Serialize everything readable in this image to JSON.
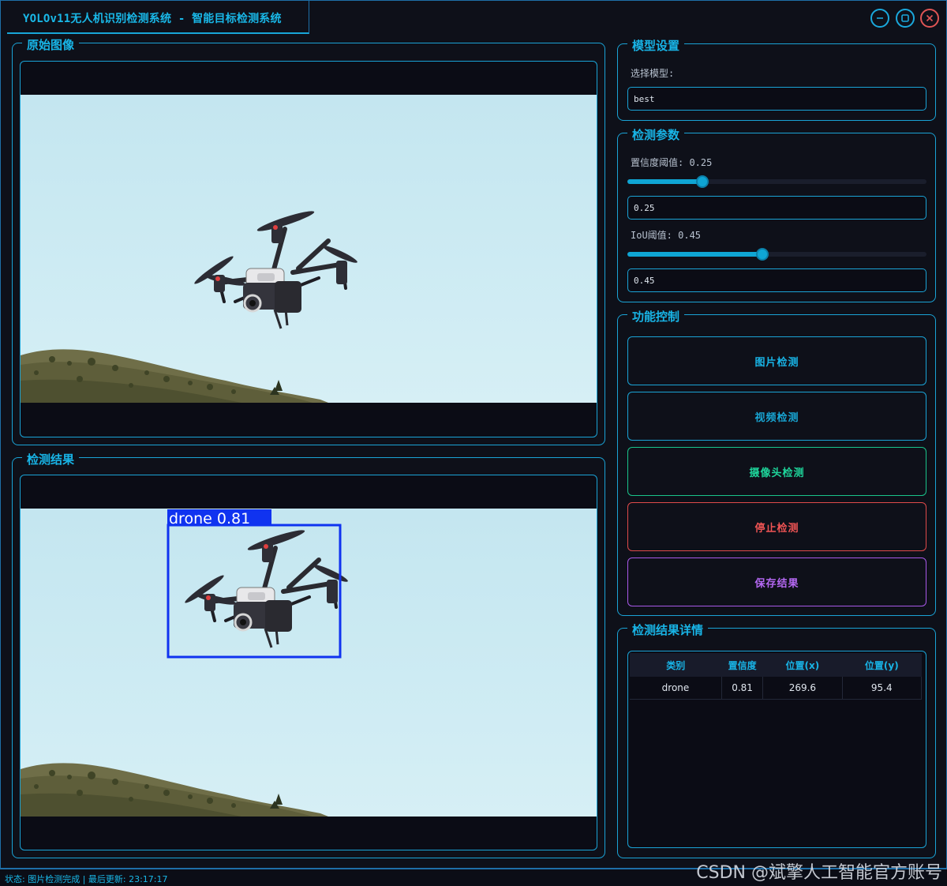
{
  "window": {
    "title": "YOLOv11无人机识别检测系统 - 智能目标检测系统"
  },
  "original_panel": {
    "title": "原始图像"
  },
  "result_panel": {
    "title": "检测结果",
    "detection_label": "drone 0.81"
  },
  "model_settings": {
    "title": "模型设置",
    "select_label": "选择模型:",
    "selected_model": "best"
  },
  "detection_params": {
    "title": "检测参数",
    "confidence_label": "置信度阈值: 0.25",
    "confidence_value": "0.25",
    "confidence_level": 0.25,
    "iou_label": "IoU阈值: 0.45",
    "iou_value": "0.45",
    "iou_level": 0.45
  },
  "function_control": {
    "title": "功能控制",
    "image_detect": "图片检测",
    "video_detect": "视频检测",
    "camera_detect": "摄像头检测",
    "stop_detect": "停止检测",
    "save_result": "保存结果"
  },
  "results_detail": {
    "title": "检测结果详情",
    "columns": [
      "类别",
      "置信度",
      "位置(x)",
      "位置(y)"
    ],
    "rows": [
      [
        "drone",
        "0.81",
        "269.6",
        "95.4"
      ]
    ]
  },
  "status": {
    "text": "状态: 图片检测完成 | 最后更新: 23:17:17"
  },
  "watermark": "CSDN @斌擎人工智能官方账号",
  "colors": {
    "accent": "#18b4e6",
    "camera_button": "#19c48a",
    "stop_button": "#e04a4a",
    "save_button": "#a858e8",
    "detection_box": "#1033f0"
  },
  "icons": [
    "minimize-icon",
    "maximize-icon",
    "close-icon"
  ]
}
